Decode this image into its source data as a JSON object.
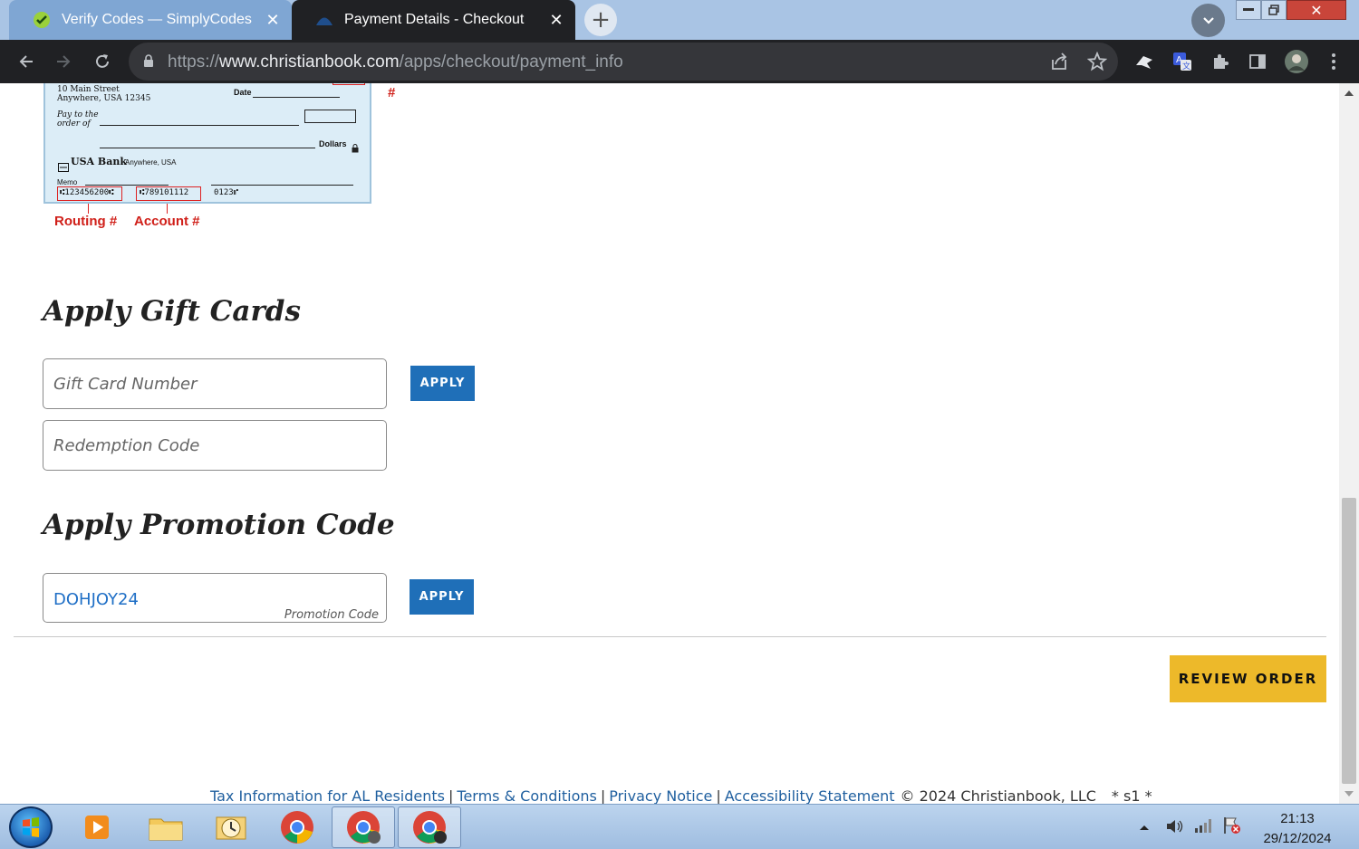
{
  "browser": {
    "tabs": [
      {
        "title": "Verify Codes — SimplyCodes",
        "active": false
      },
      {
        "title": "Payment Details - Checkout",
        "active": true
      }
    ],
    "url_scheme": "https://",
    "url_host": "www.christianbook.com",
    "url_path": "/apps/checkout/payment_info"
  },
  "check_image": {
    "address_line1": "10 Main Street",
    "address_line2": "Anywhere, USA 12345",
    "date_label": "Date",
    "pay_to_label": "Pay to the order of",
    "dollars_label": "Dollars",
    "bank_name": "USA Bank",
    "bank_location": "Anywhere, USA",
    "memo_label": "Memo",
    "routing_micr": "⑆123456200⑆",
    "account_micr": "⑆789101112",
    "check_number_micr": "0123⑈",
    "routing_label": "Routing #",
    "account_label": "Account #",
    "check_number_mark": "#"
  },
  "gift_cards": {
    "title": "Apply Gift Cards",
    "card_number_placeholder": "Gift Card Number",
    "redemption_placeholder": "Redemption Code",
    "apply_label": "APPLY"
  },
  "promotion": {
    "title": "Apply Promotion Code",
    "value": "DOHJOY24",
    "hint": "Promotion Code",
    "apply_label": "APPLY"
  },
  "review_order_label": "REVIEW ORDER",
  "footer": {
    "links": [
      "Tax Information for AL Residents",
      "Terms & Conditions",
      "Privacy Notice",
      "Accessibility Statement"
    ],
    "copyright": "© 2024 Christianbook, LLC",
    "server_marker": "* s1 *"
  },
  "taskbar": {
    "time": "21:13",
    "date": "29/12/2024"
  },
  "colors": {
    "apply_button": "#1f6fb8",
    "review_button": "#edb92a",
    "check_label_red": "#d0201a",
    "promo_value_blue": "#1f6fc6"
  }
}
